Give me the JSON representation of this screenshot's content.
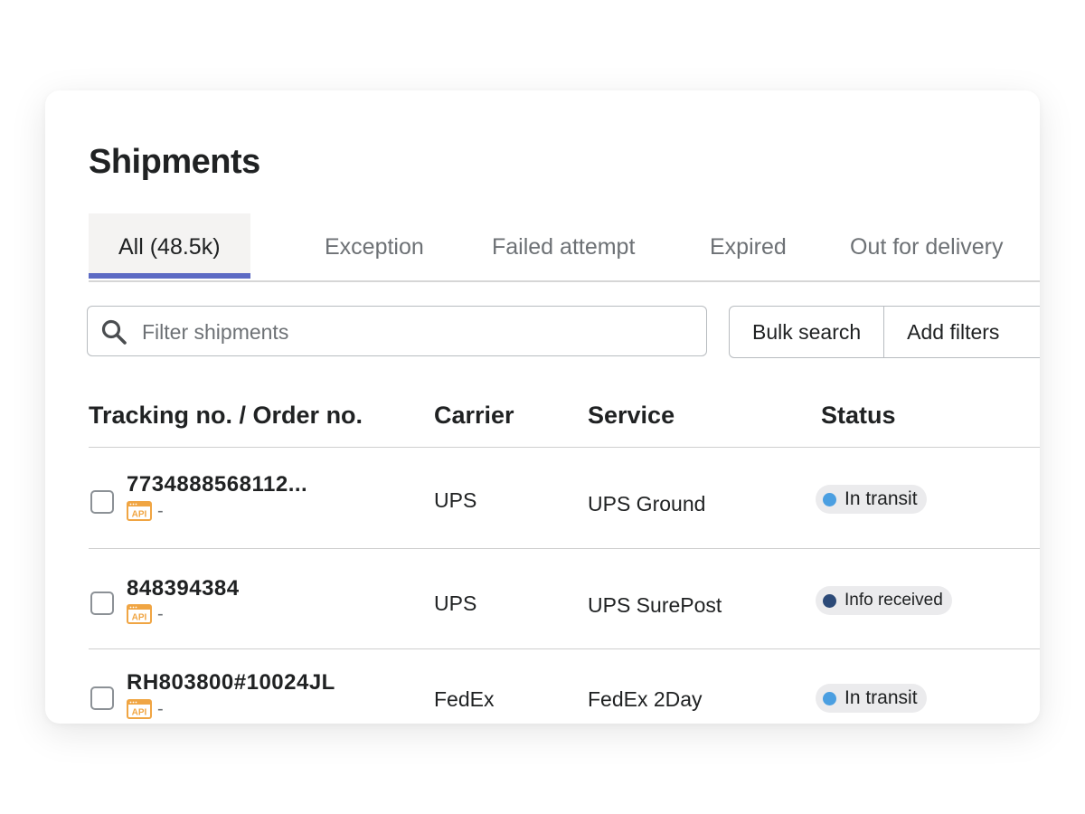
{
  "page": {
    "title": "Shipments"
  },
  "tabs": [
    {
      "label": "All (48.5k)",
      "active": true
    },
    {
      "label": "Exception",
      "active": false
    },
    {
      "label": "Failed attempt",
      "active": false
    },
    {
      "label": "Expired",
      "active": false
    },
    {
      "label": "Out for delivery",
      "active": false
    }
  ],
  "search": {
    "placeholder": "Filter shipments",
    "value": "",
    "icon": "search-icon"
  },
  "toolbar": {
    "bulk_search_label": "Bulk search",
    "add_filters_label": "Add filters"
  },
  "table": {
    "columns": [
      "Tracking no. / Order no.",
      "Carrier",
      "Service",
      "Status"
    ],
    "rows": [
      {
        "tracking": "7734888568112...",
        "source": "API",
        "order": "-",
        "carrier": "UPS",
        "service": "UPS Ground",
        "status": "In transit",
        "status_color": "#4b9fe1"
      },
      {
        "tracking": "848394384",
        "source": "API",
        "order": "-",
        "carrier": "UPS",
        "service": "UPS SurePost",
        "status": "Info received",
        "status_color": "#2c4a78"
      },
      {
        "tracking": "RH803800#10024JL",
        "source": "API",
        "order": "-",
        "carrier": "FedEx",
        "service": "FedEx 2Day",
        "status": "In transit",
        "status_color": "#4b9fe1"
      }
    ]
  },
  "colors": {
    "accent": "#5c6ac4",
    "api_badge": "#f0a543"
  }
}
